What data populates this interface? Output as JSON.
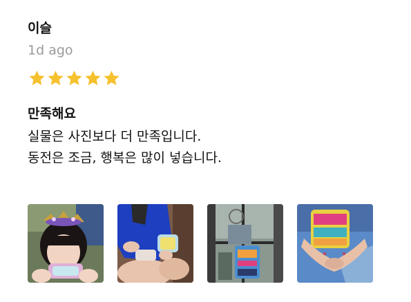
{
  "review": {
    "author": "이슬",
    "date": "1d ago",
    "rating": 5,
    "rating_max": 5,
    "star_color": "#F5C12E",
    "title": "만족해요",
    "body_lines": [
      "실물은 사진보다 더 만족입니다.",
      "동전은 조금, 행복은 많이 넣습니다."
    ]
  },
  "photos": [
    {
      "name": "photo-1"
    },
    {
      "name": "photo-2"
    },
    {
      "name": "photo-3"
    },
    {
      "name": "photo-4"
    }
  ]
}
